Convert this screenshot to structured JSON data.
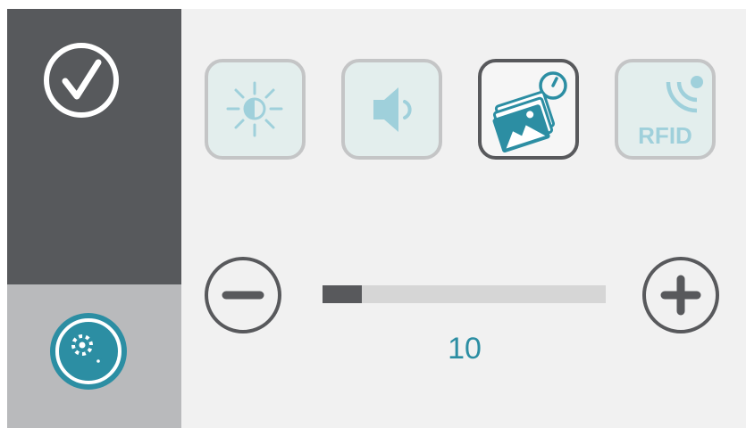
{
  "colors": {
    "sidebar_dark": "#57595c",
    "sidebar_light": "#b9babc",
    "accent_teal": "#2c8ea3",
    "icon_light_teal": "#9fd0db",
    "panel_bg": "#f1f1f1"
  },
  "sidebar": {
    "confirm_icon": "check-circle-icon",
    "settings_icon": "gears-icon"
  },
  "modes": [
    {
      "name": "brightness",
      "icon": "brightness-contrast-icon",
      "active": false
    },
    {
      "name": "volume",
      "icon": "speaker-icon",
      "active": false
    },
    {
      "name": "slideshow",
      "icon": "photos-timer-icon",
      "active": true
    },
    {
      "name": "rfid",
      "icon": "rfid-icon",
      "label": "RFID",
      "active": false
    }
  ],
  "slider": {
    "value": "10",
    "level_fraction": 0.14,
    "decrease_icon": "minus-circle-icon",
    "increase_icon": "plus-circle-icon"
  }
}
